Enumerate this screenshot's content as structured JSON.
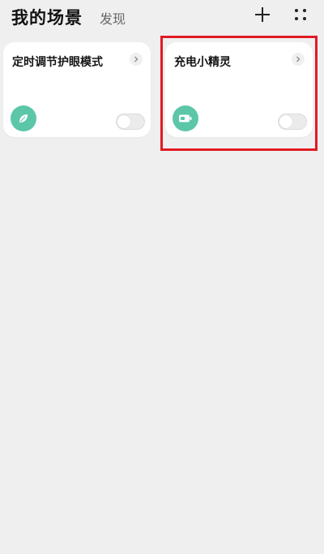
{
  "header": {
    "title": "我的场景",
    "discover_tab": "发现",
    "add_icon": "plus-icon",
    "more_icon": "four-dots-icon"
  },
  "cards": [
    {
      "title": "定时调节护眼模式",
      "icon": "leaf-icon",
      "enabled": false
    },
    {
      "title": "充电小精灵",
      "icon": "battery-icon",
      "enabled": false
    }
  ],
  "colors": {
    "accent": "#5cc6a8",
    "highlight": "#e01b24",
    "background": "#efefef"
  }
}
